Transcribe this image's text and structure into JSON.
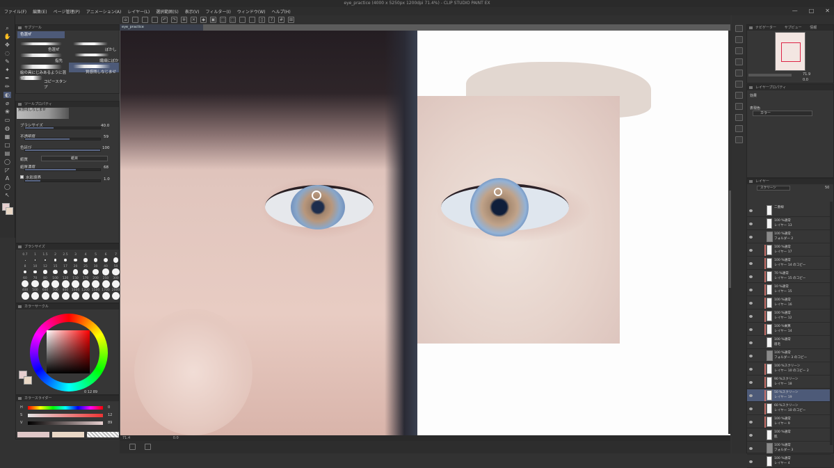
{
  "window": {
    "title": "eye_practice (4000 x 5250px 1200dpi 71.4%) - CLIP STUDIO PAINT EX",
    "controls": [
      "—",
      "□",
      "✕"
    ]
  },
  "menu": [
    "ファイル(F)",
    "編集(E)",
    "ページ管理(P)",
    "アニメーション(A)",
    "レイヤー(L)",
    "選択範囲(S)",
    "表示(V)",
    "フィルター(I)",
    "ウィンドウ(W)",
    "ヘルプ(H)"
  ],
  "canvas_tab": "eye_practice",
  "subtool": {
    "title": "サブツール",
    "group": "色混ぜ",
    "brushes": [
      "色混ぜ",
      "ぼかし",
      "指先",
      "繊細にぼかし",
      "絵の具にじみあるように混ぜ",
      "質感残しなじませ",
      "コピースタンプ"
    ]
  },
  "tool_property": {
    "title": "ツールプロパティ",
    "tool": "質感残しなじませ",
    "brush_size_label": "ブラシサイズ",
    "brush_size": "40.0",
    "opacity_label": "不透明度",
    "opacity": "59",
    "blend_label": "色延び",
    "blend": "100",
    "texture_label": "紙質",
    "texture_value": "紙目",
    "texture_density_label": "紙質濃度",
    "texture_density": "68",
    "watercolor_label": "水彩境界",
    "watercolor_value": "1.0"
  },
  "brush_size_panel": {
    "title": "ブラシサイズ",
    "sizes": [
      "0.7",
      "1",
      "1.5",
      "2",
      "2.5",
      "3",
      "4",
      "5",
      "6",
      "7",
      "8",
      "10",
      "12",
      "15",
      "17",
      "20",
      "25",
      "30",
      "40",
      "50",
      "60",
      "70",
      "80",
      "100",
      "120",
      "150",
      "170",
      "200",
      "250",
      "300",
      "400",
      "500",
      "600",
      "700",
      "800",
      "1000",
      "1200",
      "1500",
      "1700",
      "2000"
    ]
  },
  "color_wheel": {
    "title": "カラーサークル",
    "h": "0",
    "s": "12",
    "v": "89"
  },
  "color_slider": {
    "title": "カラースライダー",
    "labels": [
      "H",
      "S",
      "V"
    ],
    "values": [
      "0",
      "12",
      "89"
    ]
  },
  "status": {
    "zoom": "71.4",
    "angle": "0.0"
  },
  "navigator": {
    "title": "ナビゲーター",
    "tabs": [
      "ナビゲーター",
      "サブビュー",
      "情報"
    ],
    "zoom": "71.9",
    "angle": "0.0"
  },
  "layer_property": {
    "title": "レイヤープロパティ",
    "effect_label": "効果",
    "display_color_label": "表現色",
    "display_color": "カラー"
  },
  "layers_panel": {
    "title": "レイヤー",
    "blend_mode": "スクリーン",
    "opacity": "50",
    "rows": [
      {
        "mode": "二重線",
        "name": "",
        "type": "layer"
      },
      {
        "mode": "100 %通常",
        "name": "レイヤー 13",
        "type": "layer"
      },
      {
        "mode": "100 %通常",
        "name": "フォルダー 2",
        "type": "folder"
      },
      {
        "mode": "100 %通常",
        "name": "レイヤー 17",
        "type": "layer",
        "mark": true
      },
      {
        "mode": "100 %通常",
        "name": "レイヤー 14 のコピー",
        "type": "layer",
        "mark": true
      },
      {
        "mode": "70 %通常",
        "name": "レイヤー 15 のコピー",
        "type": "layer",
        "mark": true
      },
      {
        "mode": "10 %通常",
        "name": "レイヤー 15",
        "type": "layer",
        "mark": true
      },
      {
        "mode": "100 %通常",
        "name": "レイヤー 16",
        "type": "layer",
        "mark": true
      },
      {
        "mode": "100 %通常",
        "name": "レイヤー 12",
        "type": "layer",
        "mark": true
      },
      {
        "mode": "100 %乗算",
        "name": "レイヤー 14",
        "type": "layer",
        "mark": true
      },
      {
        "mode": "100 %通常",
        "name": "眉毛",
        "type": "layer"
      },
      {
        "mode": "100 %通常",
        "name": "フォルダー 3 のコピー",
        "type": "folder"
      },
      {
        "mode": "100 %スクリーン",
        "name": "レイヤー 10 のコピー 2",
        "type": "layer",
        "mark": true
      },
      {
        "mode": "90 %スクリーン",
        "name": "レイヤー 18",
        "type": "layer",
        "mark": true
      },
      {
        "mode": "50 %スクリーン",
        "name": "レイヤー 19",
        "type": "layer",
        "mark": true,
        "selected": true
      },
      {
        "mode": "60 %スクリーン",
        "name": "レイヤー 10 のコピー",
        "type": "layer",
        "mark": true
      },
      {
        "mode": "100 %通常",
        "name": "レイヤー 9",
        "type": "layer",
        "mark": true
      },
      {
        "mode": "100 %通常",
        "name": "肌",
        "type": "layer"
      },
      {
        "mode": "100 %通常",
        "name": "フォルダー 3",
        "type": "folder"
      },
      {
        "mode": "100 %通常",
        "name": "レイヤー 4",
        "type": "layer"
      }
    ]
  }
}
